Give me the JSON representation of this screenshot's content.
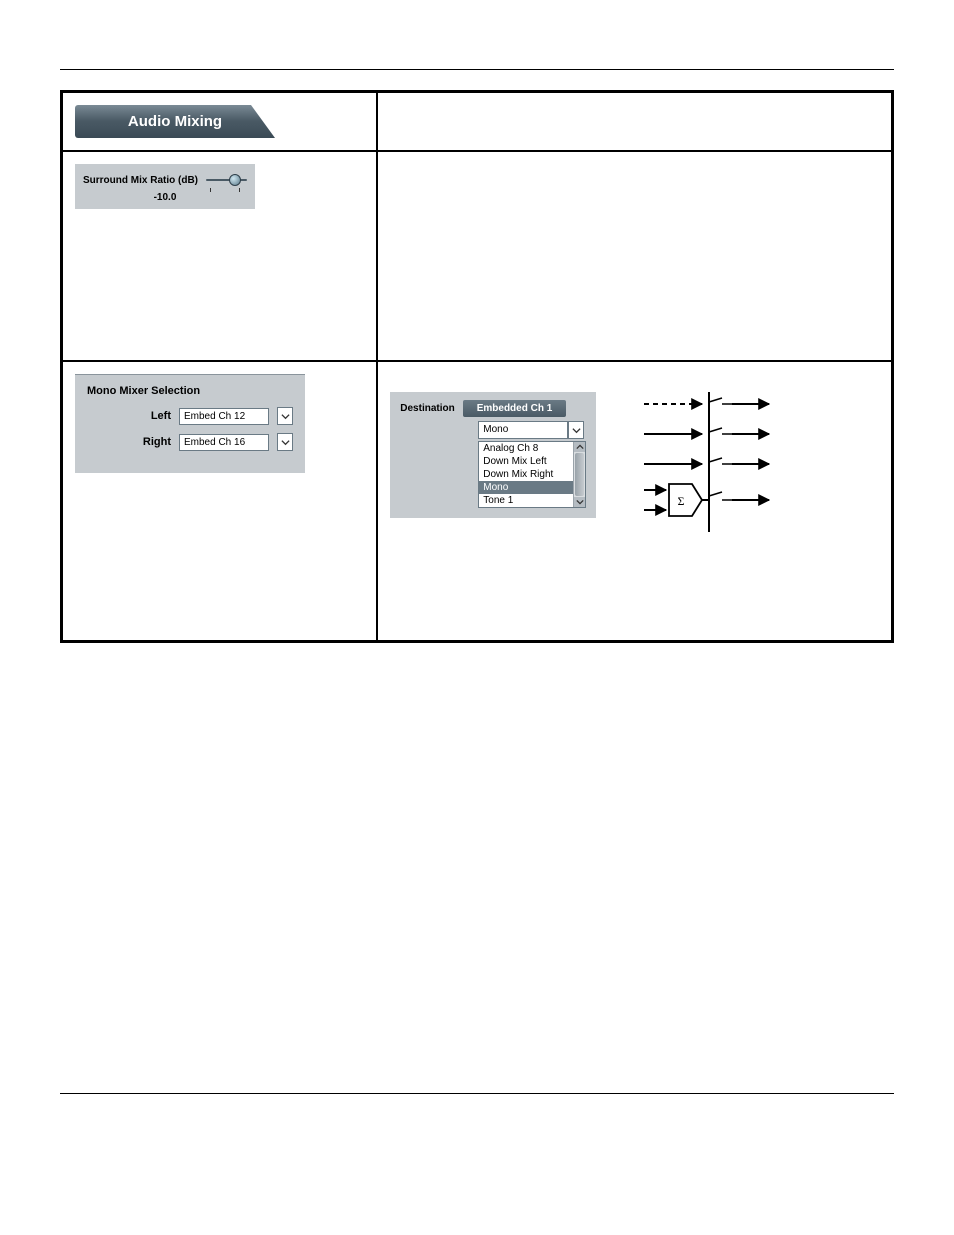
{
  "tab": {
    "title": "Audio Mixing"
  },
  "surround": {
    "label": "Surround Mix Ratio (dB)",
    "value": "-10.0"
  },
  "mono_mixer": {
    "title": "Mono Mixer Selection",
    "left_label": "Left",
    "left_value": "Embed Ch 12",
    "right_label": "Right",
    "right_value": "Embed Ch 16"
  },
  "destination": {
    "label": "Destination",
    "title": "Embedded Ch 1",
    "selected": "Mono",
    "options": [
      "Analog Ch 8",
      "Down Mix Left",
      "Down Mix Right",
      "Mono",
      "Tone 1"
    ],
    "highlighted": "Mono"
  }
}
